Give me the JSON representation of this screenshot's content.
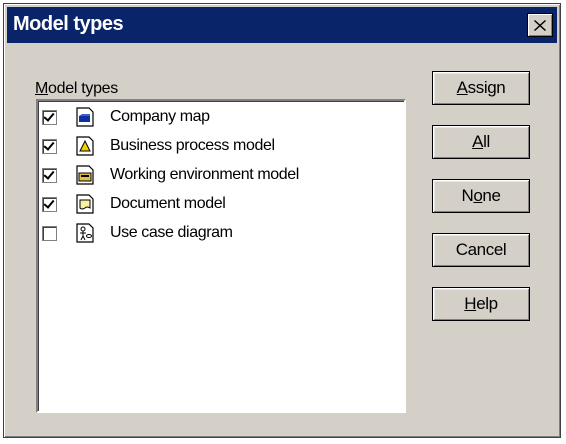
{
  "window": {
    "title": "Model types",
    "close_label": "close"
  },
  "list": {
    "label_accel": "M",
    "label_rest": "odel types",
    "items": [
      {
        "label": "Company map",
        "checked": true,
        "icon": "company-map-icon"
      },
      {
        "label": "Business process model",
        "checked": true,
        "icon": "business-process-icon"
      },
      {
        "label": "Working environment model",
        "checked": true,
        "icon": "working-environment-icon"
      },
      {
        "label": "Document model",
        "checked": true,
        "icon": "document-model-icon"
      },
      {
        "label": "Use case diagram",
        "checked": false,
        "icon": "use-case-icon"
      }
    ]
  },
  "buttons": {
    "assign": {
      "accel": "A",
      "rest": "ssign"
    },
    "all": {
      "accel": "A",
      "rest": "ll"
    },
    "none": {
      "pre": "N",
      "accel": "o",
      "rest": "ne"
    },
    "cancel": {
      "label": "Cancel"
    },
    "help": {
      "accel": "H",
      "rest": "elp"
    }
  }
}
